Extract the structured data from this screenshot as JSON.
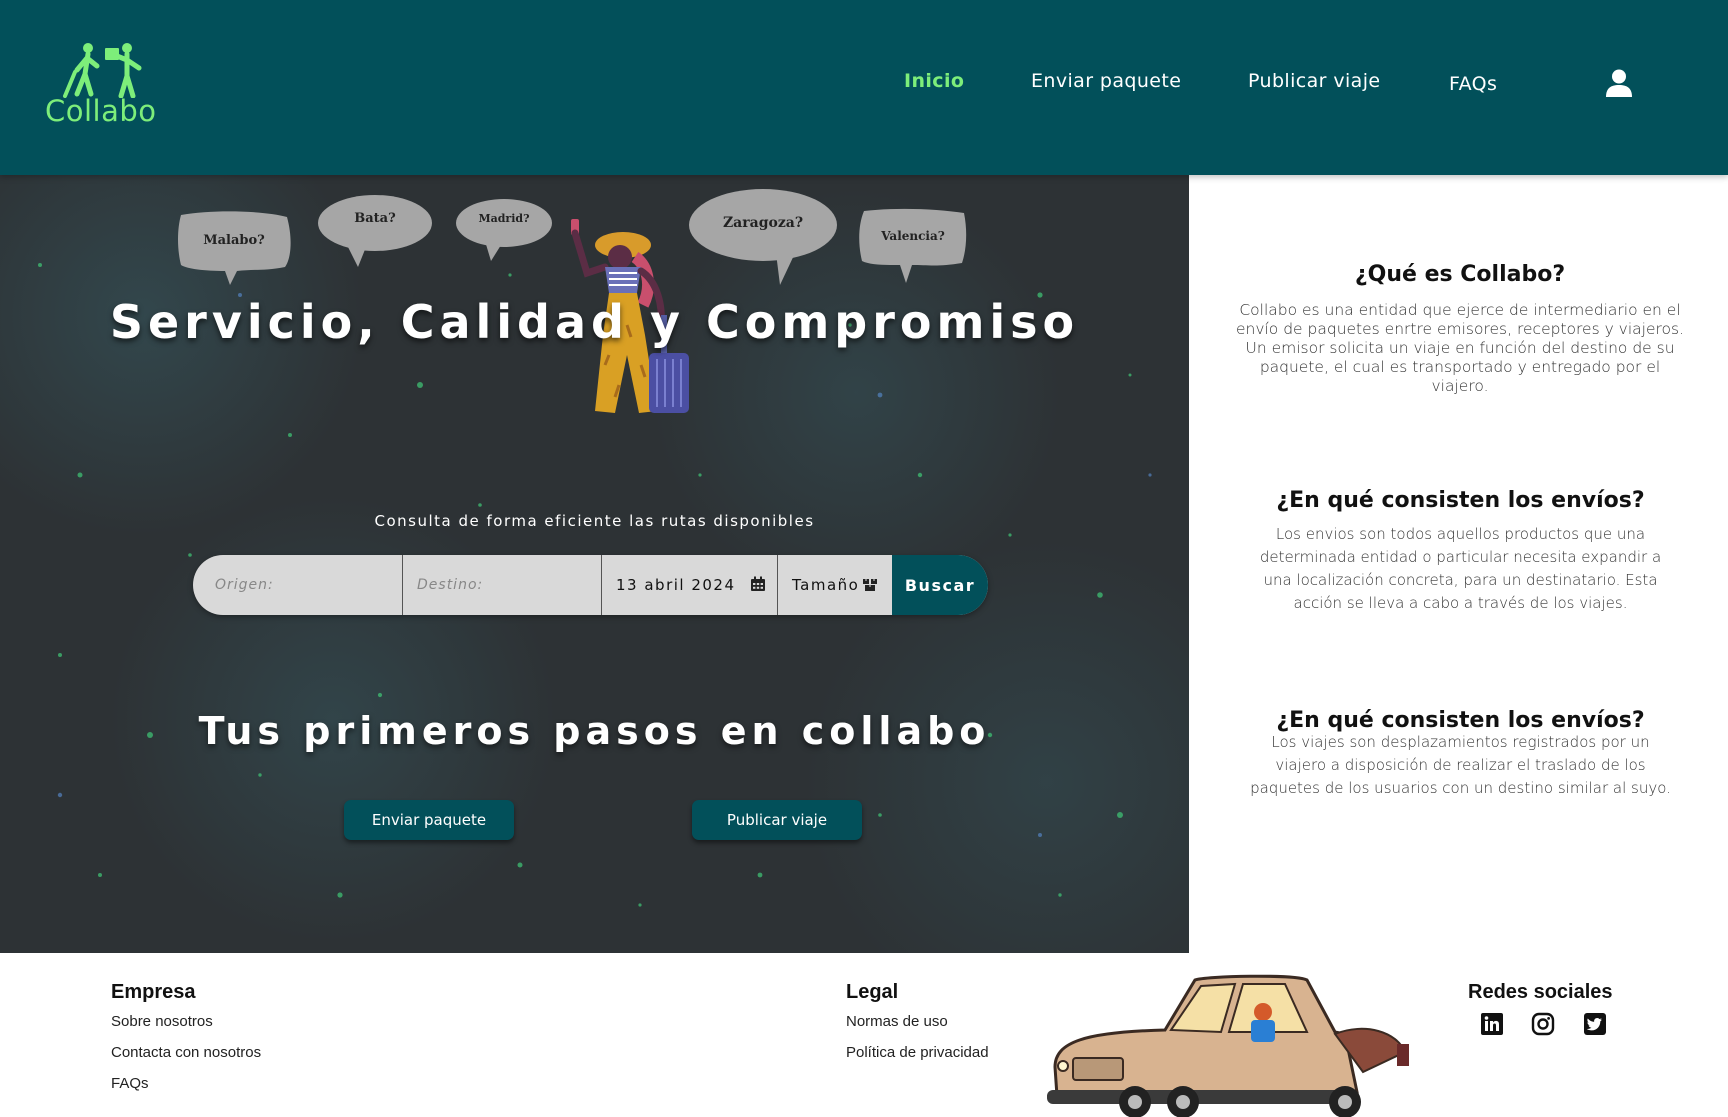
{
  "colors": {
    "brand": "#02505a",
    "accent": "#7dee7a",
    "hero_bg": "#2d3235"
  },
  "header": {
    "logo_text": "Collabo",
    "nav": [
      {
        "label": "Inicio",
        "active": true
      },
      {
        "label": "Enviar paquete",
        "active": false
      },
      {
        "label": "Publicar viaje",
        "active": false
      },
      {
        "label": "FAQs",
        "active": false
      }
    ],
    "user_icon": "user-icon"
  },
  "hero": {
    "bubbles": [
      "Malabo?",
      "Bata?",
      "Madrid?",
      "Zaragoza?",
      "Valencia?"
    ],
    "title": "Servicio, Calidad y Compromiso",
    "subtitle": "Consulta de forma eficiente las rutas disponibles",
    "search": {
      "origin_placeholder": "Origen:",
      "destination_placeholder": "Destino:",
      "date": "13 abril 2024",
      "date_icon": "calendar-icon",
      "size": "Tamaño",
      "size_icon": "boxes-icon",
      "button": "Buscar"
    },
    "steps_title": "Tus primeros pasos en collabo",
    "cta": [
      "Enviar paquete",
      "Publicar viaje"
    ]
  },
  "info": [
    {
      "title": "¿Qué es Collabo?",
      "text": "Collabo es una entidad que ejerce de intermediario en el envío de paquetes enrtre emisores, receptores y viajeros. Un emisor solicita un viaje en función del destino de su paquete, el cual es transportado y entregado por el viajero."
    },
    {
      "title": "¿En qué consisten los envíos?",
      "text": "Los envios son todos aquellos productos que una determinada entidad o particular necesita expandir a una localización concreta, para un destinatario. Esta acción se lleva a cabo a través de los viajes."
    },
    {
      "title": "¿En qué consisten los envíos?",
      "text": "Los viajes son desplazamientos registrados por un viajero a disposición de realizar el traslado de los paquetes de los usuarios con un destino similar al suyo."
    }
  ],
  "footer": {
    "empresa": {
      "title": "Empresa",
      "links": [
        "Sobre nosotros",
        "Contacta con nosotros",
        "FAQs"
      ]
    },
    "legal": {
      "title": "Legal",
      "links": [
        "Normas de uso",
        "Política de privacidad"
      ]
    },
    "social": {
      "title": "Redes sociales",
      "icons": [
        "linkedin-icon",
        "instagram-icon",
        "twitter-icon"
      ]
    }
  }
}
